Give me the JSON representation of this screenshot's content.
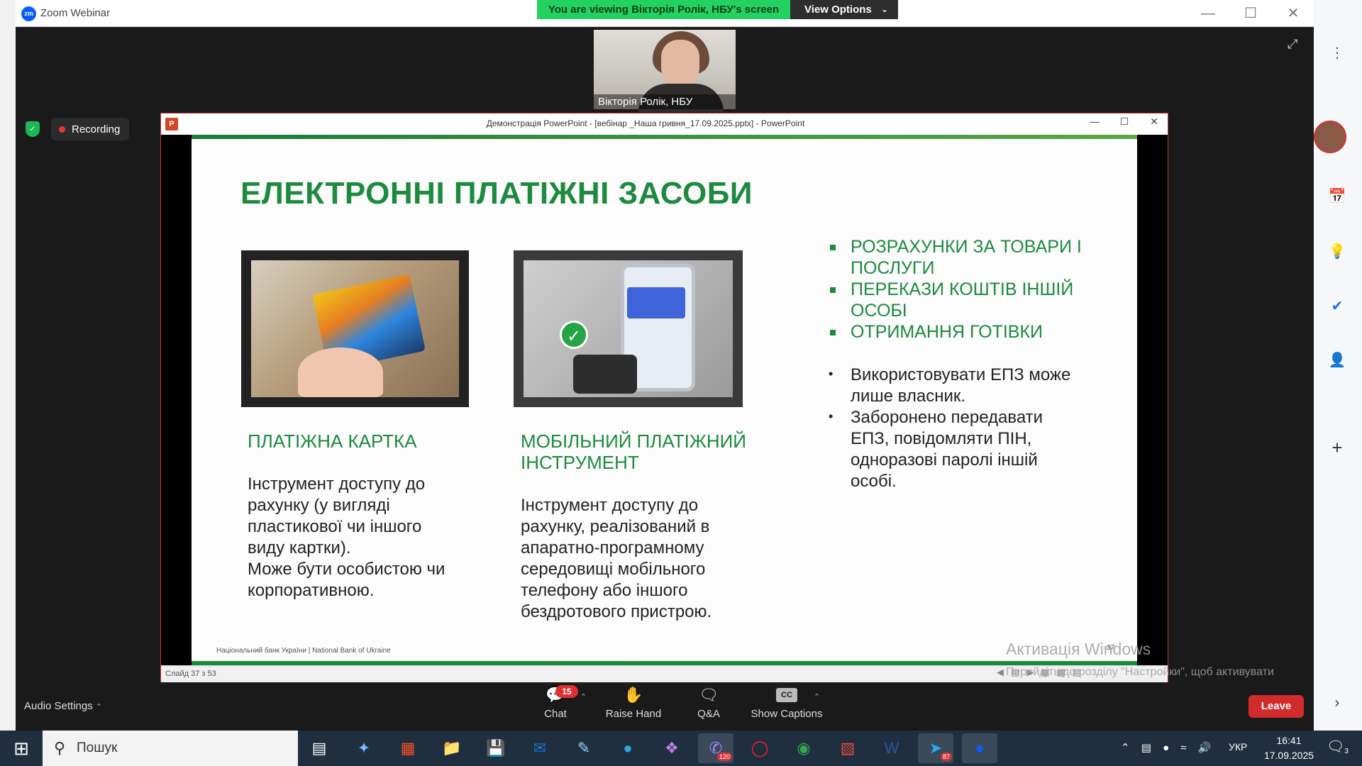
{
  "app": {
    "title": "Zoom Webinar"
  },
  "banner": {
    "viewing": "You are viewing Вікторія Ролік, НБУ's screen",
    "view_options": "View Options"
  },
  "video": {
    "name": "Вікторія Ролік, НБУ"
  },
  "recording": {
    "label": "Recording"
  },
  "ppt": {
    "title": "Демонстрація PowerPoint - [вебінар _Наша гривня_17.09.2025.pptx] - PowerPoint",
    "status": "Слайд 37 з 53"
  },
  "slide": {
    "title": "ЕЛЕКТРОННІ ПЛАТІЖНІ ЗАСОБИ",
    "card_heading": "ПЛАТІЖНА КАРТКА",
    "card_text_1": "Інструмент доступу до",
    "card_text_2": "рахунку (у вигляді",
    "card_text_3": "пластикової чи іншого",
    "card_text_4": "виду картки).",
    "card_text_5": "Може бути особистою чи",
    "card_text_6": "корпоративною.",
    "mobile_heading_1": "МОБІЛЬНИЙ ПЛАТІЖНИЙ",
    "mobile_heading_2": "ІНСТРУМЕНТ",
    "mobile_text_1": "Інструмент доступу до",
    "mobile_text_2": "рахунку, реалізований в",
    "mobile_text_3": "апаратно-програмному",
    "mobile_text_4": "середовищі мобільного",
    "mobile_text_5": "телефону або іншого",
    "mobile_text_6": "бездротового пристрою.",
    "green_bullets": [
      {
        "l1": "РОЗРАХУНКИ ЗА ТОВАРИ І",
        "l2": "ПОСЛУГИ"
      },
      {
        "l1": "ПЕРЕКАЗИ КОШТІВ ІНШІЙ",
        "l2": "ОСОБІ"
      },
      {
        "l1": "ОТРИМАННЯ ГОТІВКИ",
        "l2": ""
      }
    ],
    "black_bullets": [
      {
        "l1": "Використовувати ЕПЗ може",
        "l2": "лише власник.",
        "l3": "",
        "l4": ""
      },
      {
        "l1": "Заборонено передавати",
        "l2": "ЕПЗ, повідомляти ПІН,",
        "l3": "одноразові паролі іншій",
        "l4": "особі."
      }
    ],
    "footer": "Національний банк України | National Bank of Ukraine",
    "number": "37"
  },
  "watermark": {
    "title": "Активація Windows",
    "text": "Перейдіть до розділу \"Настройки\", щоб активувати Windows."
  },
  "toolbar": {
    "audio_settings": "Audio Settings",
    "chat": "Chat",
    "chat_badge": "15",
    "raise_hand": "Raise Hand",
    "qa": "Q&A",
    "cc": "CC",
    "show_captions": "Show Captions",
    "leave": "Leave"
  },
  "taskbar": {
    "search": "Пошук",
    "lang": "УКР",
    "time": "16:41",
    "date": "17.09.2025",
    "notif_count": "3",
    "badge_viber": "120",
    "badge_telegram": "87"
  },
  "colors": {
    "accent_green": "#1d8a3f",
    "zoom_blue": "#0b5cff",
    "leave_red": "#d22b2b",
    "banner_green": "#23d160"
  }
}
